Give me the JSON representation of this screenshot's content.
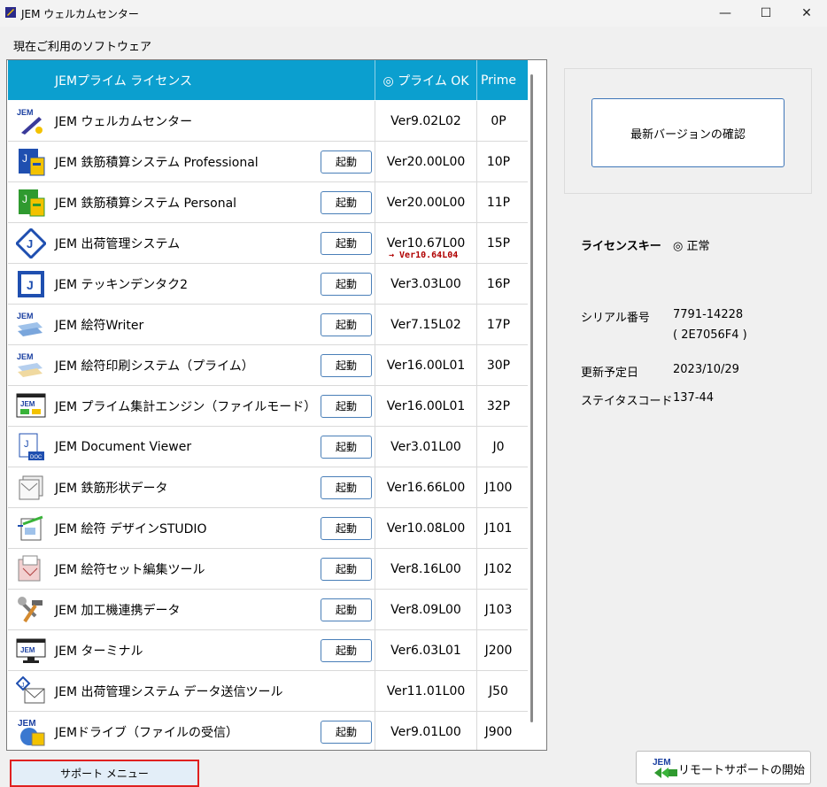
{
  "window": {
    "title": "JEM ウェルカムセンター",
    "minimize": "—",
    "maximize": "☐",
    "close": "✕"
  },
  "section_label": "現在ご利用のソフトウェア",
  "table_header": {
    "name": "JEMプライム ライセンス",
    "status": "◎ プライム OK",
    "prime": "Prime"
  },
  "apps": [
    {
      "icon": "jem-stick-icon",
      "name": "JEM ウェルカムセンター",
      "start": "",
      "ver": "Ver9.02L02",
      "ver_note": "",
      "prime": "0P"
    },
    {
      "icon": "rebar-pro-icon",
      "name": "JEM 鉄筋積算システム Professional",
      "start": "起動",
      "ver": "Ver20.00L00",
      "ver_note": "",
      "prime": "10P"
    },
    {
      "icon": "rebar-personal-icon",
      "name": "JEM 鉄筋積算システム Personal",
      "start": "起動",
      "ver": "Ver20.00L00",
      "ver_note": "",
      "prime": "11P"
    },
    {
      "icon": "shipping-diamond-icon",
      "name": "JEM 出荷管理システム",
      "start": "起動",
      "ver": "Ver10.67L00",
      "ver_note": "→ Ver10.64L04",
      "prime": "15P"
    },
    {
      "icon": "tekkin-square-icon",
      "name": "JEM テッキンデンタク2",
      "start": "起動",
      "ver": "Ver3.03L00",
      "ver_note": "",
      "prime": "16P"
    },
    {
      "icon": "writer-stack-icon",
      "name": "JEM 絵符Writer",
      "start": "起動",
      "ver": "Ver7.15L02",
      "ver_note": "",
      "prime": "17P"
    },
    {
      "icon": "print-stack-icon",
      "name": "JEM 絵符印刷システム（プライム）",
      "start": "起動",
      "ver": "Ver16.00L01",
      "ver_note": "",
      "prime": "30P"
    },
    {
      "icon": "calc-engine-icon",
      "name": "JEM プライム集計エンジン（ファイルモード）",
      "start": "起動",
      "ver": "Ver16.00L01",
      "ver_note": "",
      "prime": "32P"
    },
    {
      "icon": "doc-viewer-icon",
      "name": "JEM Document Viewer",
      "start": "起動",
      "ver": "Ver3.01L00",
      "ver_note": "",
      "prime": "J0"
    },
    {
      "icon": "shape-data-icon",
      "name": "JEM 鉄筋形状データ",
      "start": "起動",
      "ver": "Ver16.66L00",
      "ver_note": "",
      "prime": "J100"
    },
    {
      "icon": "design-studio-icon",
      "name": "JEM 絵符 デザインSTUDIO",
      "start": "起動",
      "ver": "Ver10.08L00",
      "ver_note": "",
      "prime": "J101"
    },
    {
      "icon": "set-edit-icon",
      "name": "JEM 絵符セット編集ツール",
      "start": "起動",
      "ver": "Ver8.16L00",
      "ver_note": "",
      "prime": "J102"
    },
    {
      "icon": "hammer-wrench-icon",
      "name": "JEM 加工機連携データ",
      "start": "起動",
      "ver": "Ver8.09L00",
      "ver_note": "",
      "prime": "J103"
    },
    {
      "icon": "terminal-monitor-icon",
      "name": "JEM ターミナル",
      "start": "起動",
      "ver": "Ver6.03L01",
      "ver_note": "",
      "prime": "J200"
    },
    {
      "icon": "mail-send-icon",
      "name": "JEM 出荷管理システム データ送信ツール",
      "start": "",
      "ver": "Ver11.01L00",
      "ver_note": "",
      "prime": "J50"
    },
    {
      "icon": "jem-drive-icon",
      "name": "JEMドライブ（ファイルの受信）",
      "start": "起動",
      "ver": "Ver9.01L00",
      "ver_note": "",
      "prime": "J900"
    }
  ],
  "check_button": "最新バージョンの確認",
  "license": {
    "label": "ライセンスキー",
    "value": "◎ 正常"
  },
  "serial": {
    "label": "シリアル番号",
    "value": "7791-14228",
    "sub": "( 2E7056F4 )"
  },
  "renewal": {
    "label": "更新予定日",
    "value": "2023/10/29"
  },
  "status_code": {
    "label": "ステイタスコード",
    "value": "137-44"
  },
  "support_button": "サポート メニュー",
  "remote_button": "リモートサポートの開始",
  "colors": {
    "header_bg": "#0b9fcf",
    "accent_border": "#3f76b8",
    "highlight_border": "#e02020",
    "version_note": "#b00000"
  }
}
